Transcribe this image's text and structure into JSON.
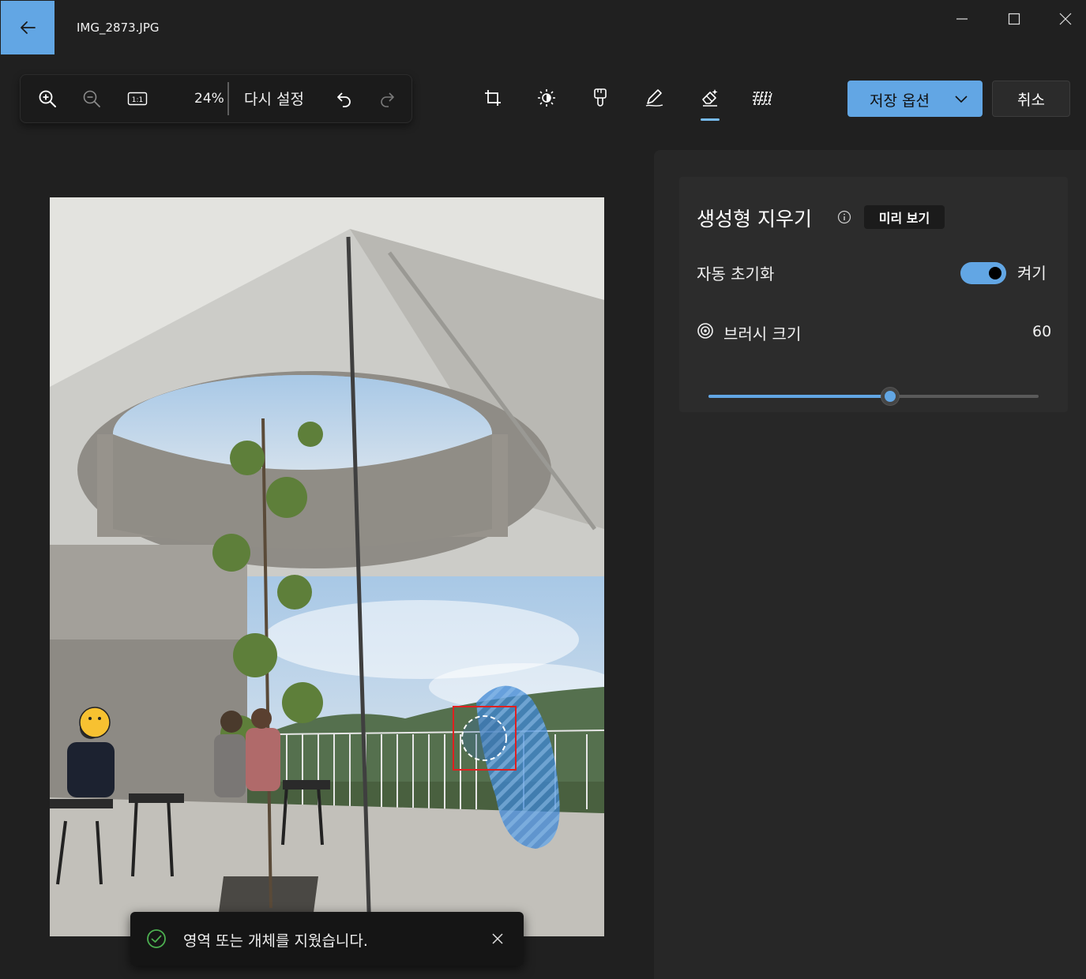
{
  "window": {
    "file_name": "IMG_2873.JPG",
    "back_icon": "arrow-left-icon",
    "minimize_icon": "minimize-icon",
    "maximize_icon": "maximize-icon",
    "close_icon": "close-icon"
  },
  "zoom_toolbar": {
    "zoom_in_icon": "zoom-in-icon",
    "zoom_out_icon": "zoom-out-icon",
    "actual_size_label": "1:1",
    "zoom_value": "24%",
    "reset_label": "다시 설정",
    "undo_icon": "undo-icon",
    "redo_icon": "redo-icon"
  },
  "edit_tools": {
    "items": [
      {
        "name": "crop",
        "icon": "crop-icon"
      },
      {
        "name": "adjust",
        "icon": "brightness-icon"
      },
      {
        "name": "filter",
        "icon": "filter-brush-icon"
      },
      {
        "name": "markup",
        "icon": "pen-icon"
      },
      {
        "name": "erase",
        "icon": "eraser-icon",
        "active": true
      },
      {
        "name": "background",
        "icon": "background-icon"
      }
    ]
  },
  "actions": {
    "save_label": "저장 옵션",
    "save_chevron_icon": "chevron-down-icon",
    "cancel_label": "취소"
  },
  "colors": {
    "accent": "#62a6e4",
    "background": "#202020",
    "panel": "#272727",
    "card": "#2c2c2c",
    "success": "#4caf50",
    "selection_box": "#e02020"
  },
  "panel": {
    "title": "생성형 지우기",
    "info_icon": "info-icon",
    "preview_badge": "미리 보기",
    "auto_reset_label": "자동 초기화",
    "auto_reset_state": "켜기",
    "brush_size_icon": "target-icon",
    "brush_size_label": "브러시 크기",
    "brush_size_value": "60",
    "brush_size_fraction": 0.55
  },
  "toast": {
    "icon": "check-circle-icon",
    "message": "영역 또는 개체를 지웠습니다.",
    "close_icon": "close-icon"
  }
}
